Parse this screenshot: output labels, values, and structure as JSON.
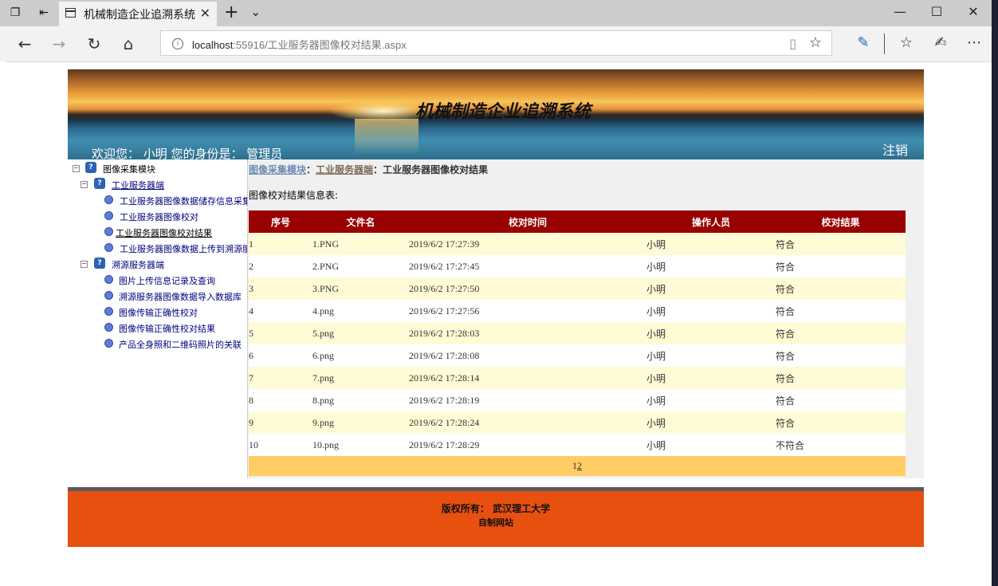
{
  "browser": {
    "tab_title": "机械制造企业追溯系统",
    "url_host": "localhost",
    "url_path": ":55916/工业服务器图像校对结果.aspx"
  },
  "header": {
    "system_title": "机械制造企业追溯系统",
    "welcome": "欢迎您：  小明     您的身份是：  管理员",
    "logout": "注销"
  },
  "sidebar": {
    "root": "图像采集模块",
    "group1": "工业服务器端",
    "group1_items": [
      "工业服务器图像数据储存信息采集",
      "工业服务器图像校对",
      "工业服务器图像校对结果",
      "工业服务器图像数据上传到溯源服"
    ],
    "group2": "溯源服务器端",
    "group2_items": [
      "图片上传信息记录及查询",
      "溯源服务器图像数据导入数据库",
      "图像传输正确性校对",
      "图像传输正确性校对结果",
      "产品全身照和二维码照片的关联"
    ]
  },
  "breadcrumb": {
    "level1": "图像采集模块",
    "sep": "：",
    "level2": "工业服务器端",
    "current": "工业服务器图像校对结果"
  },
  "caption": "图像校对结果信息表:",
  "table": {
    "columns": [
      "序号",
      "文件名",
      "校对时间",
      "操作人员",
      "校对结果"
    ],
    "rows": [
      [
        "1",
        "1.PNG",
        "2019/6/2 17:27:39",
        "小明",
        "符合"
      ],
      [
        "2",
        "2.PNG",
        "2019/6/2 17:27:45",
        "小明",
        "符合"
      ],
      [
        "3",
        "3.PNG",
        "2019/6/2 17:27:50",
        "小明",
        "符合"
      ],
      [
        "4",
        "4.png",
        "2019/6/2 17:27:56",
        "小明",
        "符合"
      ],
      [
        "5",
        "5.png",
        "2019/6/2 17:28:03",
        "小明",
        "符合"
      ],
      [
        "6",
        "6.png",
        "2019/6/2 17:28:08",
        "小明",
        "符合"
      ],
      [
        "7",
        "7.png",
        "2019/6/2 17:28:14",
        "小明",
        "符合"
      ],
      [
        "8",
        "8.png",
        "2019/6/2 17:28:19",
        "小明",
        "符合"
      ],
      [
        "9",
        "9.png",
        "2019/6/2 17:28:24",
        "小明",
        "符合"
      ],
      [
        "10",
        "10.png",
        "2019/6/2 17:28:29",
        "小明",
        "不符合"
      ]
    ],
    "pager": {
      "current": "1",
      "next": "2"
    }
  },
  "footer": {
    "copyright": "版权所有：   武汉理工大学",
    "note": "自制网站"
  },
  "colors": {
    "header_row": "#990000",
    "odd_row": "#fffbd6",
    "pager": "#ffcc66",
    "footer": "#e8500f"
  }
}
